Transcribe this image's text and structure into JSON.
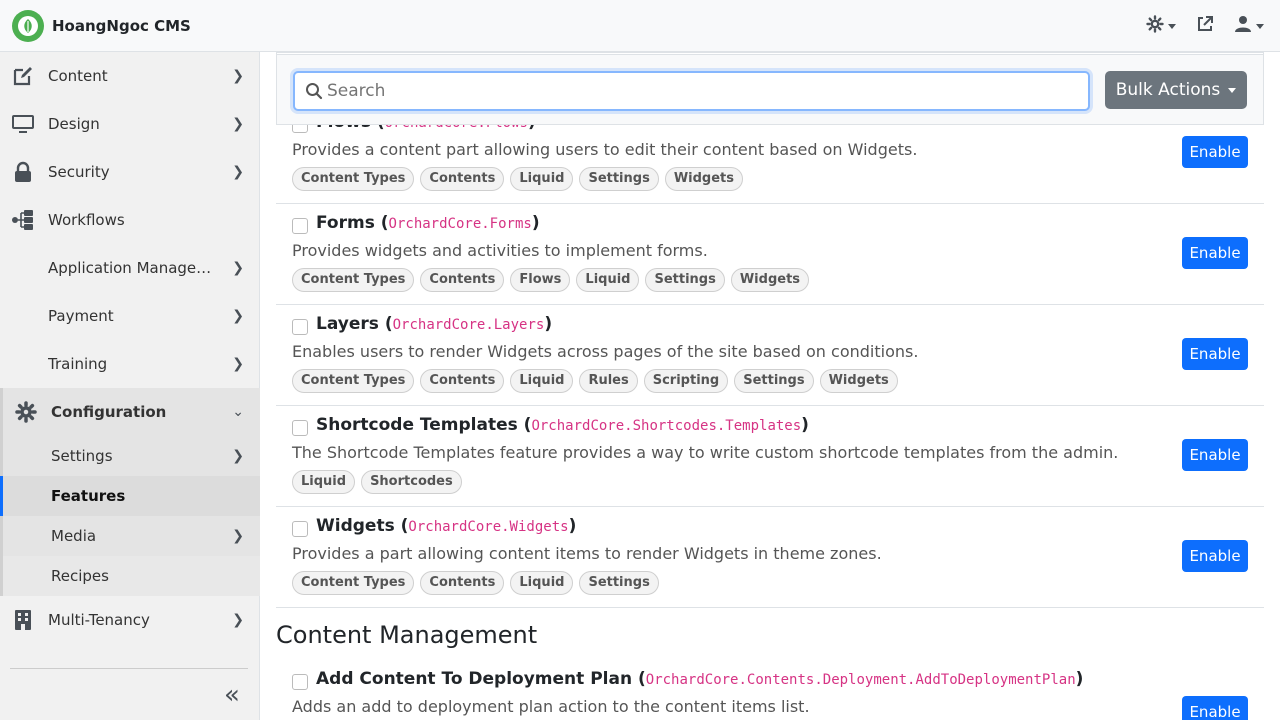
{
  "app": {
    "name": "HoangNgoc CMS"
  },
  "topbar": {
    "theme_icon": "gear-icon",
    "visit_icon": "external-link-icon",
    "user_icon": "user-icon"
  },
  "sidebar": {
    "items": [
      {
        "label": "Content",
        "icon": "edit-icon"
      },
      {
        "label": "Design",
        "icon": "monitor-icon"
      },
      {
        "label": "Security",
        "icon": "lock-icon"
      },
      {
        "label": "Workflows",
        "icon": "workflow-icon"
      },
      {
        "label": "Application Management",
        "icon": ""
      },
      {
        "label": "Payment",
        "icon": ""
      },
      {
        "label": "Training",
        "icon": ""
      },
      {
        "label": "Configuration",
        "icon": "gear-icon"
      },
      {
        "label": "Multi-Tenancy",
        "icon": "building-icon"
      }
    ],
    "config_sub": [
      {
        "label": "Settings"
      },
      {
        "label": "Features"
      },
      {
        "label": "Media"
      },
      {
        "label": "Recipes"
      }
    ],
    "collapse_label": "«"
  },
  "search": {
    "placeholder": "Search",
    "value": ""
  },
  "bulk_actions": {
    "label": "Bulk Actions"
  },
  "features": [
    {
      "name": "Flows",
      "id": "OrchardCore.Flows",
      "description": "Provides a content part allowing users to edit their content based on Widgets.",
      "tags": [
        "Content Types",
        "Contents",
        "Liquid",
        "Settings",
        "Widgets"
      ],
      "button": "Enable"
    },
    {
      "name": "Forms",
      "id": "OrchardCore.Forms",
      "description": "Provides widgets and activities to implement forms.",
      "tags": [
        "Content Types",
        "Contents",
        "Flows",
        "Liquid",
        "Settings",
        "Widgets"
      ],
      "button": "Enable"
    },
    {
      "name": "Layers",
      "id": "OrchardCore.Layers",
      "description": "Enables users to render Widgets across pages of the site based on conditions.",
      "tags": [
        "Content Types",
        "Contents",
        "Liquid",
        "Rules",
        "Scripting",
        "Settings",
        "Widgets"
      ],
      "button": "Enable"
    },
    {
      "name": "Shortcode Templates",
      "id": "OrchardCore.Shortcodes.Templates",
      "description": "The Shortcode Templates feature provides a way to write custom shortcode templates from the admin.",
      "tags": [
        "Liquid",
        "Shortcodes"
      ],
      "button": "Enable"
    },
    {
      "name": "Widgets",
      "id": "OrchardCore.Widgets",
      "description": "Provides a part allowing content items to render Widgets in theme zones.",
      "tags": [
        "Content Types",
        "Contents",
        "Liquid",
        "Settings"
      ],
      "button": "Enable"
    }
  ],
  "section": {
    "title": "Content Management"
  },
  "next_feature": {
    "name": "Add Content To Deployment Plan",
    "id": "OrchardCore.Contents.Deployment.AddToDeploymentPlan",
    "description": "Adds an add to deployment plan action to the content items list.",
    "button": "Enable"
  }
}
